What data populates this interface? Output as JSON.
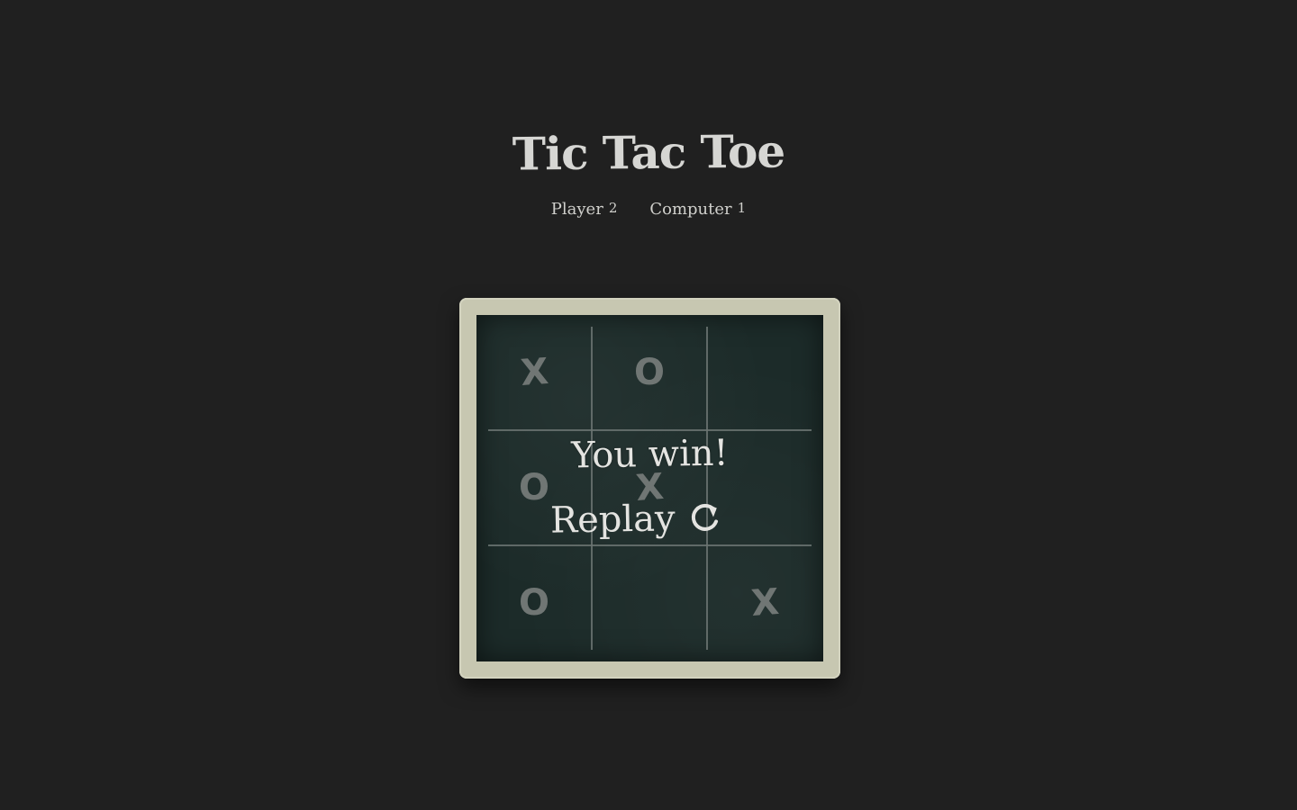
{
  "page": {
    "title": "Tic Tac Toe"
  },
  "scoreboard": {
    "player_label": "Player",
    "player_score": "2",
    "computer_label": "Computer",
    "computer_score": "1"
  },
  "board": {
    "cells": [
      "x",
      "o",
      "",
      "o",
      "x",
      "",
      "o",
      "",
      "x"
    ],
    "mark_text": {
      "x": "X",
      "o": "O"
    }
  },
  "result": {
    "message": "You win!",
    "replay_label": "Replay",
    "replay_icon": "refresh-icon"
  },
  "colors": {
    "background": "#202020",
    "frame": "#c7c7b1",
    "chalkboard": "#1c2b29",
    "chalk": "#e4e4e1",
    "faded_mark": "#707674"
  }
}
